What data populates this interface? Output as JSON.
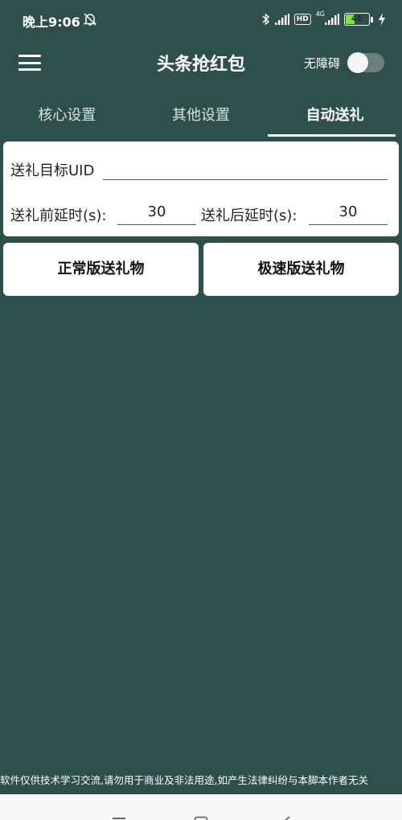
{
  "status_bar": {
    "time": "晚上9:06",
    "network_label": "4G",
    "hd_label": "HD",
    "battery_level": "41",
    "battery_fraction": 0.41,
    "battery_color": "#7ee34a",
    "icons": [
      "bell-off-icon",
      "bluetooth-icon",
      "signal-icon",
      "hd-icon",
      "signal-4g-icon",
      "battery-icon",
      "charging-icon"
    ]
  },
  "app_bar": {
    "title": "头条抢红包",
    "menu_icon": "menu-icon",
    "accessibility_label": "无障碍",
    "accessibility_enabled": false
  },
  "tabs": [
    {
      "label": "核心设置",
      "active": false
    },
    {
      "label": "其他设置",
      "active": false
    },
    {
      "label": "自动送礼",
      "active": true
    }
  ],
  "form": {
    "uid_label": "送礼目标UID",
    "uid_value": "",
    "pre_delay_label": "送礼前延时(s):",
    "pre_delay_value": "30",
    "post_delay_label": "送礼后延时(s):",
    "post_delay_value": "30"
  },
  "buttons": {
    "normal_label": "正常版送礼物",
    "fast_label": "极速版送礼物"
  },
  "footer": {
    "disclaimer": "软件仅供技术学习交流,请勿用于商业及非法用途,如产生法律纠纷与本脚本作者无关"
  },
  "nav_bar": {
    "icons": [
      "menu-nav-icon",
      "home-nav-icon",
      "back-nav-icon"
    ]
  },
  "theme": {
    "background": "#2f4f4c",
    "card": "#ffffff",
    "text_on_dark": "#ffffff"
  }
}
